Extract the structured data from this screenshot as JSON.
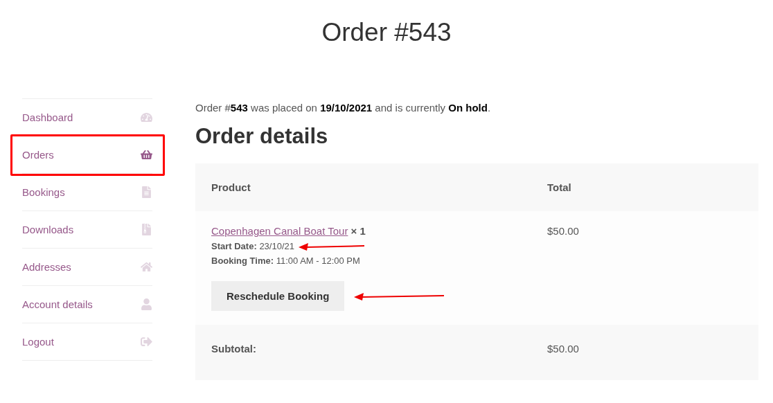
{
  "page_title": "Order #543",
  "sidebar": {
    "items": [
      {
        "label": "Dashboard",
        "selected": false
      },
      {
        "label": "Orders",
        "selected": true
      },
      {
        "label": "Bookings",
        "selected": false
      },
      {
        "label": "Downloads",
        "selected": false
      },
      {
        "label": "Addresses",
        "selected": false
      },
      {
        "label": "Account details",
        "selected": false
      },
      {
        "label": "Logout",
        "selected": false
      }
    ]
  },
  "order_notice": "Order #**543** was placed on **19/10/2021** and is currently **On hold**.",
  "section_title": "Order details",
  "table": {
    "columns": [
      "Product",
      "Total"
    ],
    "item": {
      "product": "Copenhagen Canal Boat Tour",
      "quantity": "× 1",
      "meta": [
        {
          "label": "Start Date:",
          "value": "23/10/21"
        },
        {
          "label": "Booking Time:",
          "value": "11:00 AM - 12:00 PM"
        }
      ],
      "button": "Reschedule Booking",
      "total": "$50.00"
    },
    "subtotal": {
      "label": "Subtotal:",
      "value": "$50.00"
    }
  }
}
